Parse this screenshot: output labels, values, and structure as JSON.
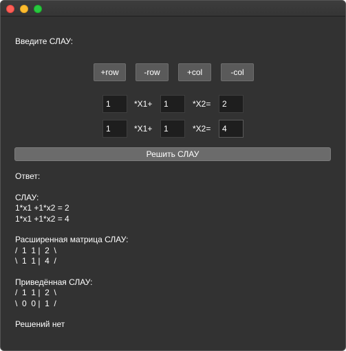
{
  "window": {
    "title": ""
  },
  "prompt_label": "Введите СЛАУ:",
  "toolbar": {
    "add_row": "+row",
    "remove_row": "-row",
    "add_col": "+col",
    "remove_col": "-col"
  },
  "equations": [
    {
      "a1": "1",
      "x1_label": "*X1+",
      "a2": "1",
      "x2_label": "*X2=",
      "b": "2"
    },
    {
      "a1": "1",
      "x1_label": "*X1+",
      "a2": "1",
      "x2_label": "*X2=",
      "b": "4"
    }
  ],
  "solve_button": "Решить СЛАУ",
  "output": {
    "lines": [
      "Ответ:",
      "",
      "СЛАУ:",
      "1*x1 +1*x2 = 2",
      "1*x1 +1*x2 = 4",
      "",
      "Расширенная матрица СЛАУ:",
      "/  1  1 |  2  \\",
      "\\  1  1 |  4  /",
      "",
      "Приведённая СЛАУ:",
      "/  1  1 |  2  \\",
      "\\  0  0 |  1  /",
      "",
      "Решений нет"
    ]
  }
}
